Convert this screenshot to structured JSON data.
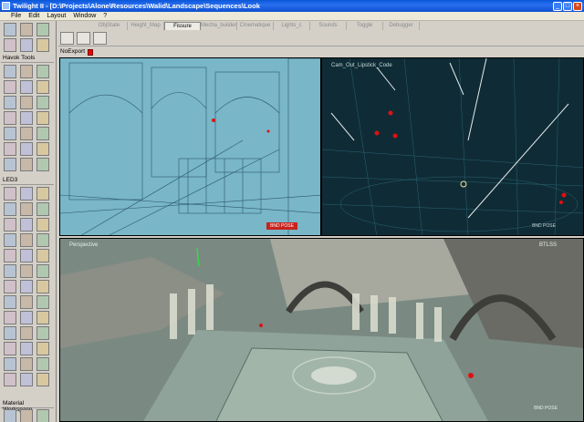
{
  "window": {
    "title": "Twilight II - [D:\\Projects\\Alone\\Resources\\Walid\\Landscape\\Sequences\\Look",
    "minimize": "_",
    "maximize": "□",
    "close": "×"
  },
  "menu": [
    "File",
    "Edit",
    "Layout",
    "Window",
    "?"
  ],
  "tabs": [
    "ObjState",
    "Height_Map",
    "Fissure",
    "Mecha_builder",
    "Cinematique",
    "Lights_c",
    "Sounds",
    "Toggle",
    "Debugger"
  ],
  "active_tab": "Fissure",
  "left_panel": {
    "havok_label": "Havok Tools",
    "led_label": "LED3",
    "material_label": "Material Workspace"
  },
  "noexport": "NoExport",
  "viewports": {
    "top_right_label": "Cam_Out_Lipstick_Code",
    "bottom_left_label": "Perspective",
    "bottom_right_label": "BTLSS",
    "pos_badge_tl": "BND POSE",
    "pos_badge_tr": "BND POSE",
    "pos_badge_b": "BND POSE"
  },
  "colors": {
    "titlebar": "#0a57d8",
    "wire_viewport_bg": "#78b6c8",
    "dark_viewport_bg": "#0f2c36",
    "marker_red": "#e01010"
  }
}
